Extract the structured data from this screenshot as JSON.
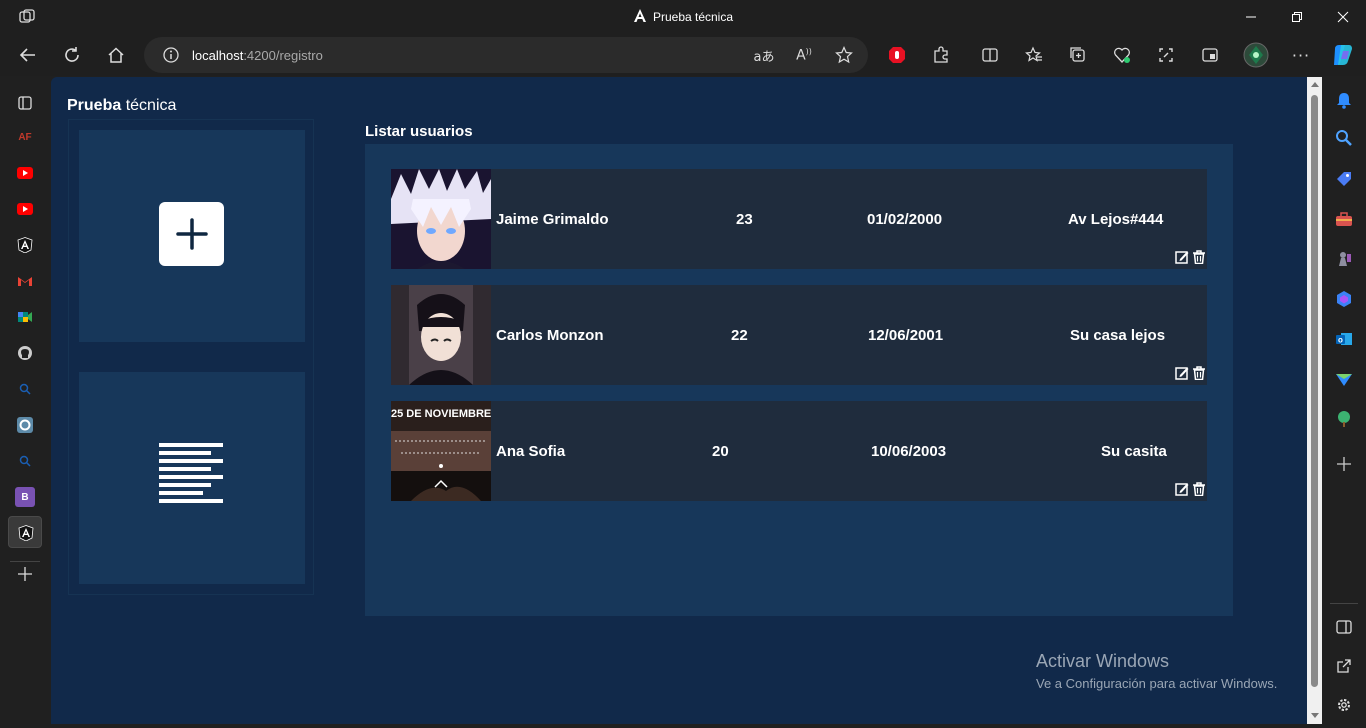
{
  "window": {
    "title": "Prueba técnica",
    "controls": [
      "minimize",
      "maximize",
      "close"
    ]
  },
  "browser": {
    "url_host": "localhost",
    "url_rest": ":4200/registro",
    "toolbar_icons": [
      "back-icon",
      "refresh-icon",
      "home-icon",
      "info-icon",
      "translate-icon",
      "read-aloud-icon",
      "favorite-icon",
      "adblock-icon",
      "extensions-icon",
      "split-screen-icon",
      "favorites-icon",
      "collections-icon",
      "health-icon",
      "screenshot-icon",
      "browser-essentials-icon",
      "profile-icon",
      "more-icon",
      "copilot-icon"
    ],
    "left_rail": [
      {
        "name": "tab-actions-icon",
        "label": ""
      },
      {
        "name": "tab-af",
        "label": "AF",
        "color": "#c0392b"
      },
      {
        "name": "tab-youtube-1",
        "label": "",
        "color": "#ff0000"
      },
      {
        "name": "tab-youtube-2",
        "label": "",
        "color": "#ff0000"
      },
      {
        "name": "tab-angular",
        "label": "A",
        "color": "#ffffff"
      },
      {
        "name": "tab-gmail",
        "label": "M",
        "color": "#ea4335"
      },
      {
        "name": "tab-meet",
        "label": "",
        "color": "#00897b"
      },
      {
        "name": "tab-github",
        "label": "",
        "color": "#cccccc"
      },
      {
        "name": "tab-search-1",
        "label": "",
        "color": "#1a5fb4"
      },
      {
        "name": "tab-circle",
        "label": "",
        "color": "#7fb3d5"
      },
      {
        "name": "tab-search-2",
        "label": "",
        "color": "#1a5fb4"
      },
      {
        "name": "tab-bootstrap",
        "label": "B",
        "color": "#7952b3"
      },
      {
        "name": "tab-angular-active",
        "label": "A",
        "color": "#ffffff"
      }
    ]
  },
  "app": {
    "brand_bold": "Prueba",
    "brand_rest": " técnica",
    "section_title": "Listar usuarios",
    "users": [
      {
        "name": "Jaime Grimaldo",
        "age": "23",
        "birthdate": "01/02/2000",
        "address": "Av Lejos#444"
      },
      {
        "name": "Carlos Monzon",
        "age": "22",
        "birthdate": "12/06/2001",
        "address": "Su casa lejos"
      },
      {
        "name": "Ana Sofia",
        "age": "20",
        "birthdate": "10/06/2003",
        "address": "Su casita",
        "image_caption": "25 DE NOVIEMBRE"
      }
    ]
  },
  "watermark": {
    "line1": "Activar Windows",
    "line2": "Ve a Configuración para activar Windows."
  }
}
